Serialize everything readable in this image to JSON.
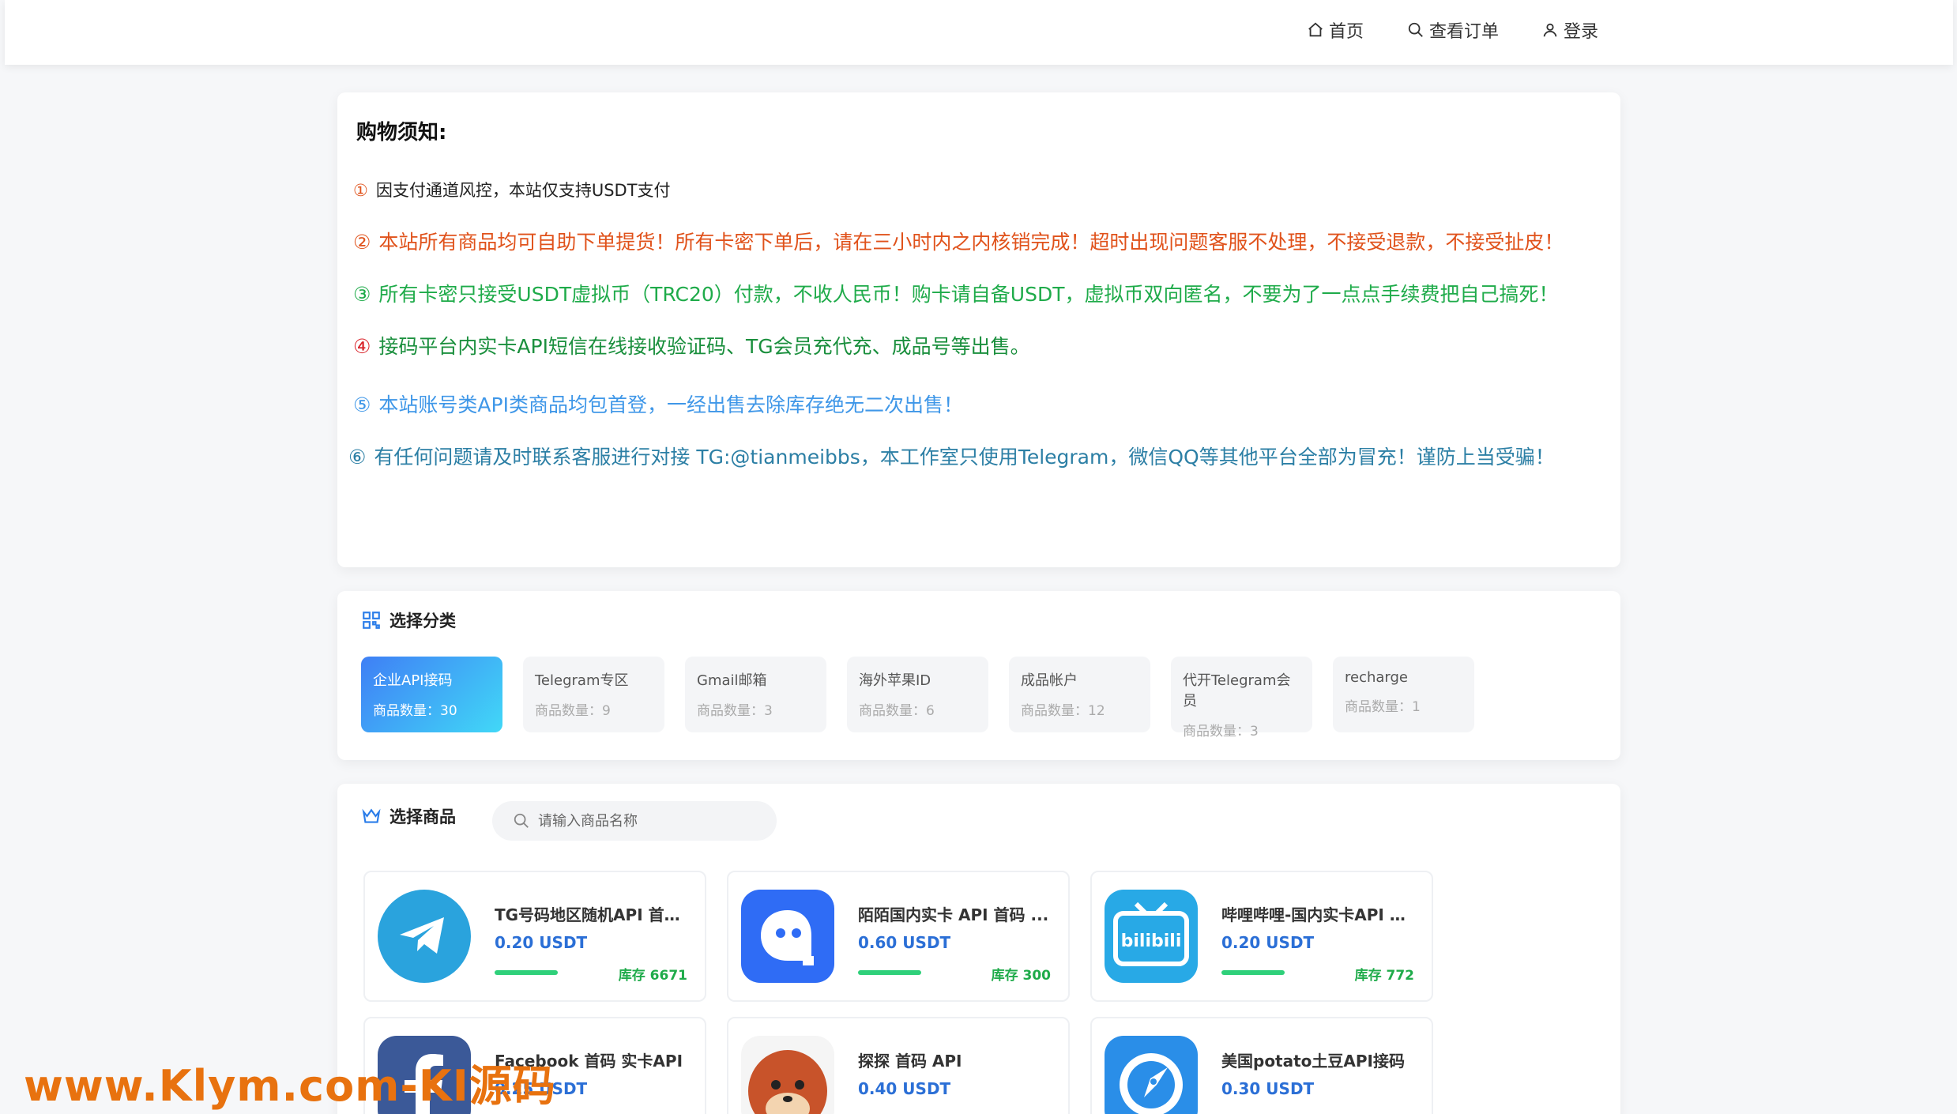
{
  "nav": {
    "home": "首页",
    "orders": "查看订单",
    "login": "登录"
  },
  "notice": {
    "title": "购物须知:",
    "items": [
      {
        "num": "①",
        "text": "因支付通道风控，本站仅支持USDT支付"
      },
      {
        "num": "②",
        "text": "本站所有商品均可自助下单提货！所有卡密下单后，请在三小时内之内核销完成！超时出现问题客服不处理，不接受退款，不接受扯皮！"
      },
      {
        "num": "③",
        "text": "所有卡密只接受USDT虚拟币（TRC20）付款，不收人民币！购卡请自备USDT，虚拟币双向匿名，不要为了一点点手续费把自己搞死！"
      },
      {
        "num": "④",
        "text": "接码平台内实卡API短信在线接收验证码、TG会员充代充、成品号等出售。"
      },
      {
        "num": "⑤",
        "text": "本站账号类API类商品均包首登，一经出售去除库存绝无二次出售！"
      },
      {
        "num": "⑥",
        "text": "有任何问题请及时联系客服进行对接  TG:@tianmeibbs，本工作室只使用Telegram，微信QQ等其他平台全部为冒充！谨防上当受骗！"
      }
    ]
  },
  "categories": {
    "title": "选择分类",
    "items": [
      {
        "name": "企业API接码",
        "count": "商品数量：30",
        "active": true
      },
      {
        "name": "Telegram专区",
        "count": "商品数量：9"
      },
      {
        "name": "Gmail邮箱",
        "count": "商品数量：3"
      },
      {
        "name": "海外苹果ID",
        "count": "商品数量：6"
      },
      {
        "name": "成品帐户",
        "count": "商品数量：12"
      },
      {
        "name": "代开Telegram会员",
        "count": "商品数量：3"
      },
      {
        "name": "recharge",
        "count": "商品数量：1"
      }
    ]
  },
  "goods": {
    "title": "选择商品",
    "search_placeholder": "请输入商品名称",
    "items": [
      {
        "name": "TG号码地区随机API 首码 ...",
        "price": "0.20 USDT",
        "stock": "库存 6671",
        "icon": "telegram-icon"
      },
      {
        "name": "陌陌国内实卡 API 首码 ...",
        "price": "0.60 USDT",
        "stock": "库存 300",
        "icon": "momo-icon"
      },
      {
        "name": "哔哩哔哩-国内实卡API 首码",
        "price": "0.20 USDT",
        "stock": "库存 772",
        "icon": "bilibili-icon"
      },
      {
        "name": "Facebook 首码 实卡API",
        "price": "0.25 USDT",
        "stock": "",
        "icon": "facebook-icon"
      },
      {
        "name": "探探 首码 API",
        "price": "0.40 USDT",
        "stock": "",
        "icon": "tantan-icon"
      },
      {
        "name": "美国potato土豆API接码",
        "price": "0.30 USDT",
        "stock": "",
        "icon": "potato-icon"
      }
    ]
  },
  "watermark": "www.Klym.com-KI源码",
  "colors": {
    "accent_blue": "#2b6fd6",
    "stock_green": "#1fab4a",
    "warning_orange": "#e0521b"
  }
}
